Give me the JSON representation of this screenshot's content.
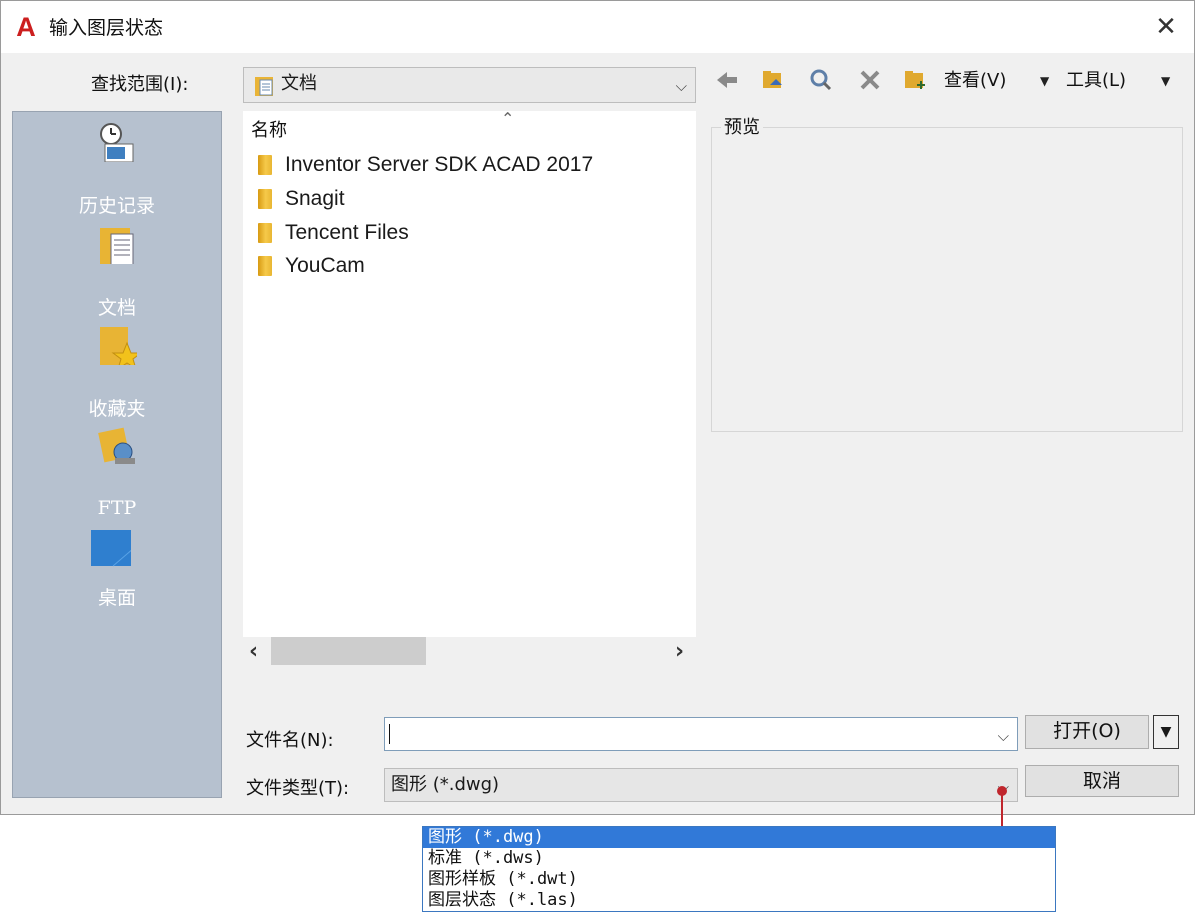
{
  "window": {
    "title": "输入图层状态",
    "close_label": "✕"
  },
  "lookin": {
    "label": "查找范围(I):",
    "value": "文档"
  },
  "toolbar": {
    "view_label": "查看(V)",
    "tools_label": "工具(L)"
  },
  "places": [
    {
      "label": "历史记录",
      "icon": "history-icon"
    },
    {
      "label": "文档",
      "icon": "documents-icon"
    },
    {
      "label": "收藏夹",
      "icon": "favorites-icon"
    },
    {
      "label": "FTP",
      "icon": "ftp-icon"
    },
    {
      "label": "桌面",
      "icon": "desktop-icon"
    }
  ],
  "filelist": {
    "column_name": "名称",
    "items": [
      {
        "name": "Inventor Server SDK ACAD 2017"
      },
      {
        "name": "Snagit"
      },
      {
        "name": "Tencent Files"
      },
      {
        "name": "YouCam"
      }
    ]
  },
  "preview": {
    "label": "预览"
  },
  "filename": {
    "label": "文件名(N):",
    "value": ""
  },
  "filetype": {
    "label": "文件类型(T):",
    "value": "图形 (*.dwg)",
    "options": [
      "图形 (*.dwg)",
      "标准 (*.dws)",
      "图形样板 (*.dwt)",
      "图层状态 (*.las)"
    ]
  },
  "buttons": {
    "open_label": "打开(O)",
    "cancel_label": "取消"
  },
  "colors": {
    "places_bg": "#b6c1cf",
    "selection_blue": "#3179d8",
    "logo_red": "#cc1f1f",
    "connector_red": "#c0262d"
  }
}
